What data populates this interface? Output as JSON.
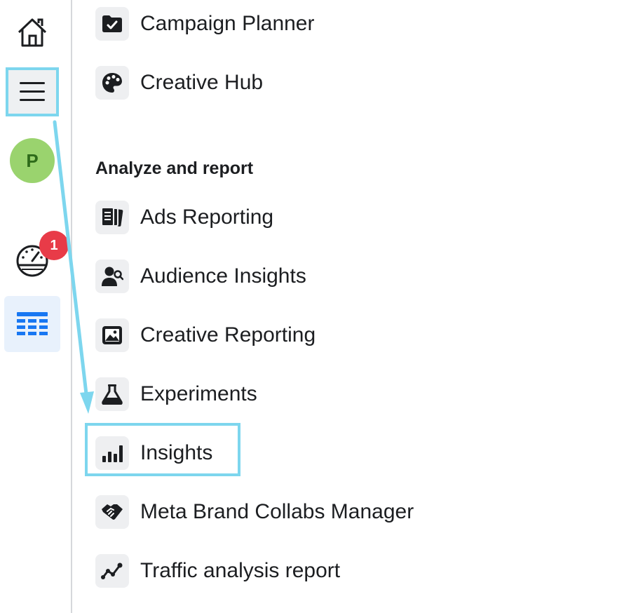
{
  "rail": {
    "home": {
      "icon": "home-icon"
    },
    "menu": {
      "icon": "hamburger-menu-icon"
    },
    "avatar": {
      "initial": "P",
      "color": "#9ad36e"
    },
    "gauge": {
      "icon": "gauge-icon",
      "badge_count": "1",
      "badge_color": "#e83b48"
    },
    "grid": {
      "icon": "table-grid-icon",
      "color": "#1877f2"
    }
  },
  "menu": {
    "top_items": [
      {
        "label": "Campaign Planner",
        "icon": "folder-check-icon"
      },
      {
        "label": "Creative Hub",
        "icon": "palette-icon"
      }
    ],
    "section_heading": "Analyze and report",
    "items": [
      {
        "label": "Ads Reporting",
        "icon": "report-pages-icon"
      },
      {
        "label": "Audience Insights",
        "icon": "person-search-icon"
      },
      {
        "label": "Creative Reporting",
        "icon": "image-icon"
      },
      {
        "label": "Experiments",
        "icon": "flask-icon"
      },
      {
        "label": "Insights",
        "icon": "bar-chart-icon"
      },
      {
        "label": "Meta Brand Collabs Manager",
        "icon": "handshake-icon"
      },
      {
        "label": "Traffic analysis report",
        "icon": "trend-line-icon"
      }
    ]
  },
  "annotation": {
    "highlight_color": "#7dd6ee"
  }
}
